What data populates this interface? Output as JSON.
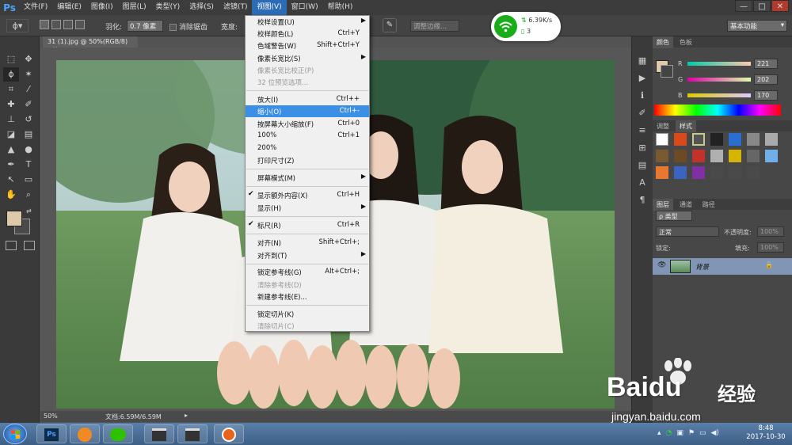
{
  "menubar": {
    "logo": "Ps",
    "items": [
      "文件(F)",
      "编辑(E)",
      "图像(I)",
      "图层(L)",
      "类型(Y)",
      "选择(S)",
      "滤镜(T)",
      "视图(V)",
      "窗口(W)",
      "帮助(H)"
    ],
    "active_index": 7,
    "window_buttons": [
      "—",
      "□",
      "✕"
    ]
  },
  "options": {
    "feather_label": "羽化:",
    "feather_value": "0.7 像素",
    "antialias_label": "消除锯齿",
    "style_label": "宽度:",
    "refine_edge_label": "调整边缘...",
    "workspace": "基本功能"
  },
  "document": {
    "tab_title": "31 (1).jpg @ 50%(RGB/8)",
    "zoom": "50%",
    "doc_info": "文档:6.59M/6.59M"
  },
  "view_menu": {
    "items": [
      {
        "label": "校样设置(U)",
        "shortcut": "",
        "submenu": true,
        "disabled": false
      },
      {
        "label": "校样颜色(L)",
        "shortcut": "Ctrl+Y",
        "submenu": false,
        "disabled": false
      },
      {
        "label": "色域警告(W)",
        "shortcut": "Shift+Ctrl+Y",
        "submenu": false,
        "disabled": false
      },
      {
        "label": "像素长宽比(S)",
        "shortcut": "",
        "submenu": true,
        "disabled": false
      },
      {
        "label": "像素长宽比校正(P)",
        "shortcut": "",
        "submenu": false,
        "disabled": true
      },
      {
        "label": "32 位预览选项...",
        "shortcut": "",
        "submenu": false,
        "disabled": true
      },
      {
        "label": "放大(I)",
        "shortcut": "Ctrl++",
        "submenu": false,
        "disabled": false
      },
      {
        "label": "缩小(O)",
        "shortcut": "Ctrl+-",
        "submenu": false,
        "disabled": false,
        "highlight": true
      },
      {
        "label": "按屏幕大小缩放(F)",
        "shortcut": "Ctrl+0",
        "submenu": false,
        "disabled": false
      },
      {
        "label": "100%",
        "shortcut": "Ctrl+1",
        "submenu": false,
        "disabled": false
      },
      {
        "label": "200%",
        "shortcut": "",
        "submenu": false,
        "disabled": false
      },
      {
        "label": "打印尺寸(Z)",
        "shortcut": "",
        "submenu": false,
        "disabled": false
      },
      {
        "label": "屏幕模式(M)",
        "shortcut": "",
        "submenu": true,
        "disabled": false
      },
      {
        "label": "显示额外内容(X)",
        "shortcut": "Ctrl+H",
        "submenu": false,
        "disabled": false,
        "checked": true
      },
      {
        "label": "显示(H)",
        "shortcut": "",
        "submenu": true,
        "disabled": false
      },
      {
        "label": "标尺(R)",
        "shortcut": "Ctrl+R",
        "submenu": false,
        "disabled": false,
        "checked": true
      },
      {
        "label": "对齐(N)",
        "shortcut": "Shift+Ctrl+;",
        "submenu": false,
        "disabled": false
      },
      {
        "label": "对齐到(T)",
        "shortcut": "",
        "submenu": true,
        "disabled": false
      },
      {
        "label": "锁定参考线(G)",
        "shortcut": "Alt+Ctrl+;",
        "submenu": false,
        "disabled": false
      },
      {
        "label": "清除参考线(D)",
        "shortcut": "",
        "submenu": false,
        "disabled": true
      },
      {
        "label": "新建参考线(E)...",
        "shortcut": "",
        "submenu": false,
        "disabled": false
      },
      {
        "label": "锁定切片(K)",
        "shortcut": "",
        "submenu": false,
        "disabled": false
      },
      {
        "label": "清除切片(C)",
        "shortcut": "",
        "submenu": false,
        "disabled": true
      }
    ]
  },
  "network_widget": {
    "speed": "6.39K/s",
    "count": "3"
  },
  "color_panel": {
    "tabs": [
      "颜色",
      "色板"
    ],
    "channels": [
      {
        "name": "R",
        "value": "221"
      },
      {
        "name": "G",
        "value": "202"
      },
      {
        "name": "B",
        "value": "170"
      }
    ],
    "foreground_color": "#ddcaaa"
  },
  "styles_panel": {
    "tabs": [
      "调整",
      "样式"
    ]
  },
  "layers_panel": {
    "tabs": [
      "图层",
      "通道",
      "路径"
    ],
    "filter_label": "ρ 类型",
    "blend_mode": "正常",
    "opacity_label": "不透明度:",
    "opacity_value": "100%",
    "lock_label": "锁定:",
    "fill_label": "填充:",
    "fill_value": "100%",
    "layer_name": "背景"
  },
  "taskbar": {
    "time": "8:48",
    "date": "2017-10-30"
  },
  "watermark": {
    "brand": "Bai",
    "brand_du": "du",
    "jingyan": "经验",
    "url": "jingyan.baidu.com"
  },
  "colors": {
    "accent_blue": "#3b8fe5",
    "wifi_green": "#1aad19"
  }
}
